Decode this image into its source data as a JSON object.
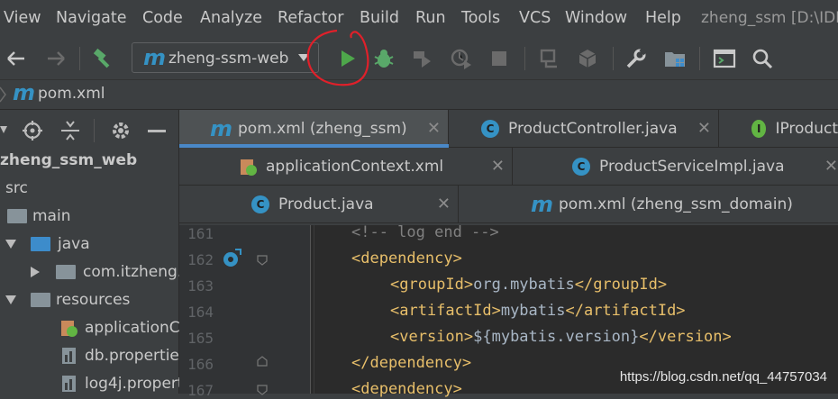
{
  "menu": {
    "items": [
      "View",
      "Navigate",
      "Code",
      "Analyze",
      "Refactor",
      "Build",
      "Run",
      "Tools",
      "VCS",
      "Window",
      "Help"
    ],
    "project_title": "zheng_ssm [D:\\IDE"
  },
  "toolbar": {
    "run_config": "zheng-ssm-web",
    "icons": [
      "back-arrow-icon",
      "forward-arrow-icon",
      "build-hammer-icon",
      "run-icon",
      "debug-icon",
      "coverage-icon",
      "profile-icon",
      "stop-icon",
      "attach-icon",
      "deploy-icon",
      "settings-wrench-icon",
      "project-structure-icon",
      "terminal-icon",
      "search-icon"
    ],
    "run_color": "#4ea74b",
    "debug_color": "#59a869"
  },
  "breadcrumb": {
    "file": "pom.xml"
  },
  "project": {
    "root": "zheng_ssm_web",
    "tree": [
      {
        "label": "src"
      },
      {
        "label": "main"
      },
      {
        "label": "java"
      },
      {
        "label": "com.itzheng."
      },
      {
        "label": "resources"
      },
      {
        "label": "applicationCo"
      },
      {
        "label": "db.propertie"
      },
      {
        "label": "log4j.propert"
      }
    ]
  },
  "tabs": {
    "row1": [
      {
        "label": "pom.xml (zheng_ssm)",
        "close": "✕"
      },
      {
        "label": "ProductController.java",
        "close": "✕"
      },
      {
        "label": "IProduct"
      }
    ],
    "row2": [
      {
        "label": "applicationContext.xml",
        "close": "✕"
      },
      {
        "label": "ProductServiceImpl.java",
        "close": "✕"
      }
    ],
    "row3": [
      {
        "label": "Product.java",
        "close": "✕"
      },
      {
        "label": "pom.xml (zheng_ssm_domain)"
      }
    ]
  },
  "editor": {
    "line_numbers": [
      "161",
      "162",
      "163",
      "164",
      "165",
      "166",
      "167"
    ],
    "lines": {
      "l161": "<!-- log end -->",
      "l162_open": "<dependency>",
      "l163_open": "<groupId>",
      "l163_val": "org.mybatis",
      "l163_close": "</groupId>",
      "l164_open": "<artifactId>",
      "l164_val": "mybatis",
      "l164_close": "</artifactId>",
      "l165_open": "<version>",
      "l165_val": "${mybatis.version}",
      "l165_close": "</version>",
      "l166": "</dependency>",
      "l167": "<dependency>"
    }
  },
  "watermark": "https://blog.csdn.net/qq_44757034",
  "colors": {
    "accent": "#4a88c7",
    "annotation": "#e0202a"
  }
}
